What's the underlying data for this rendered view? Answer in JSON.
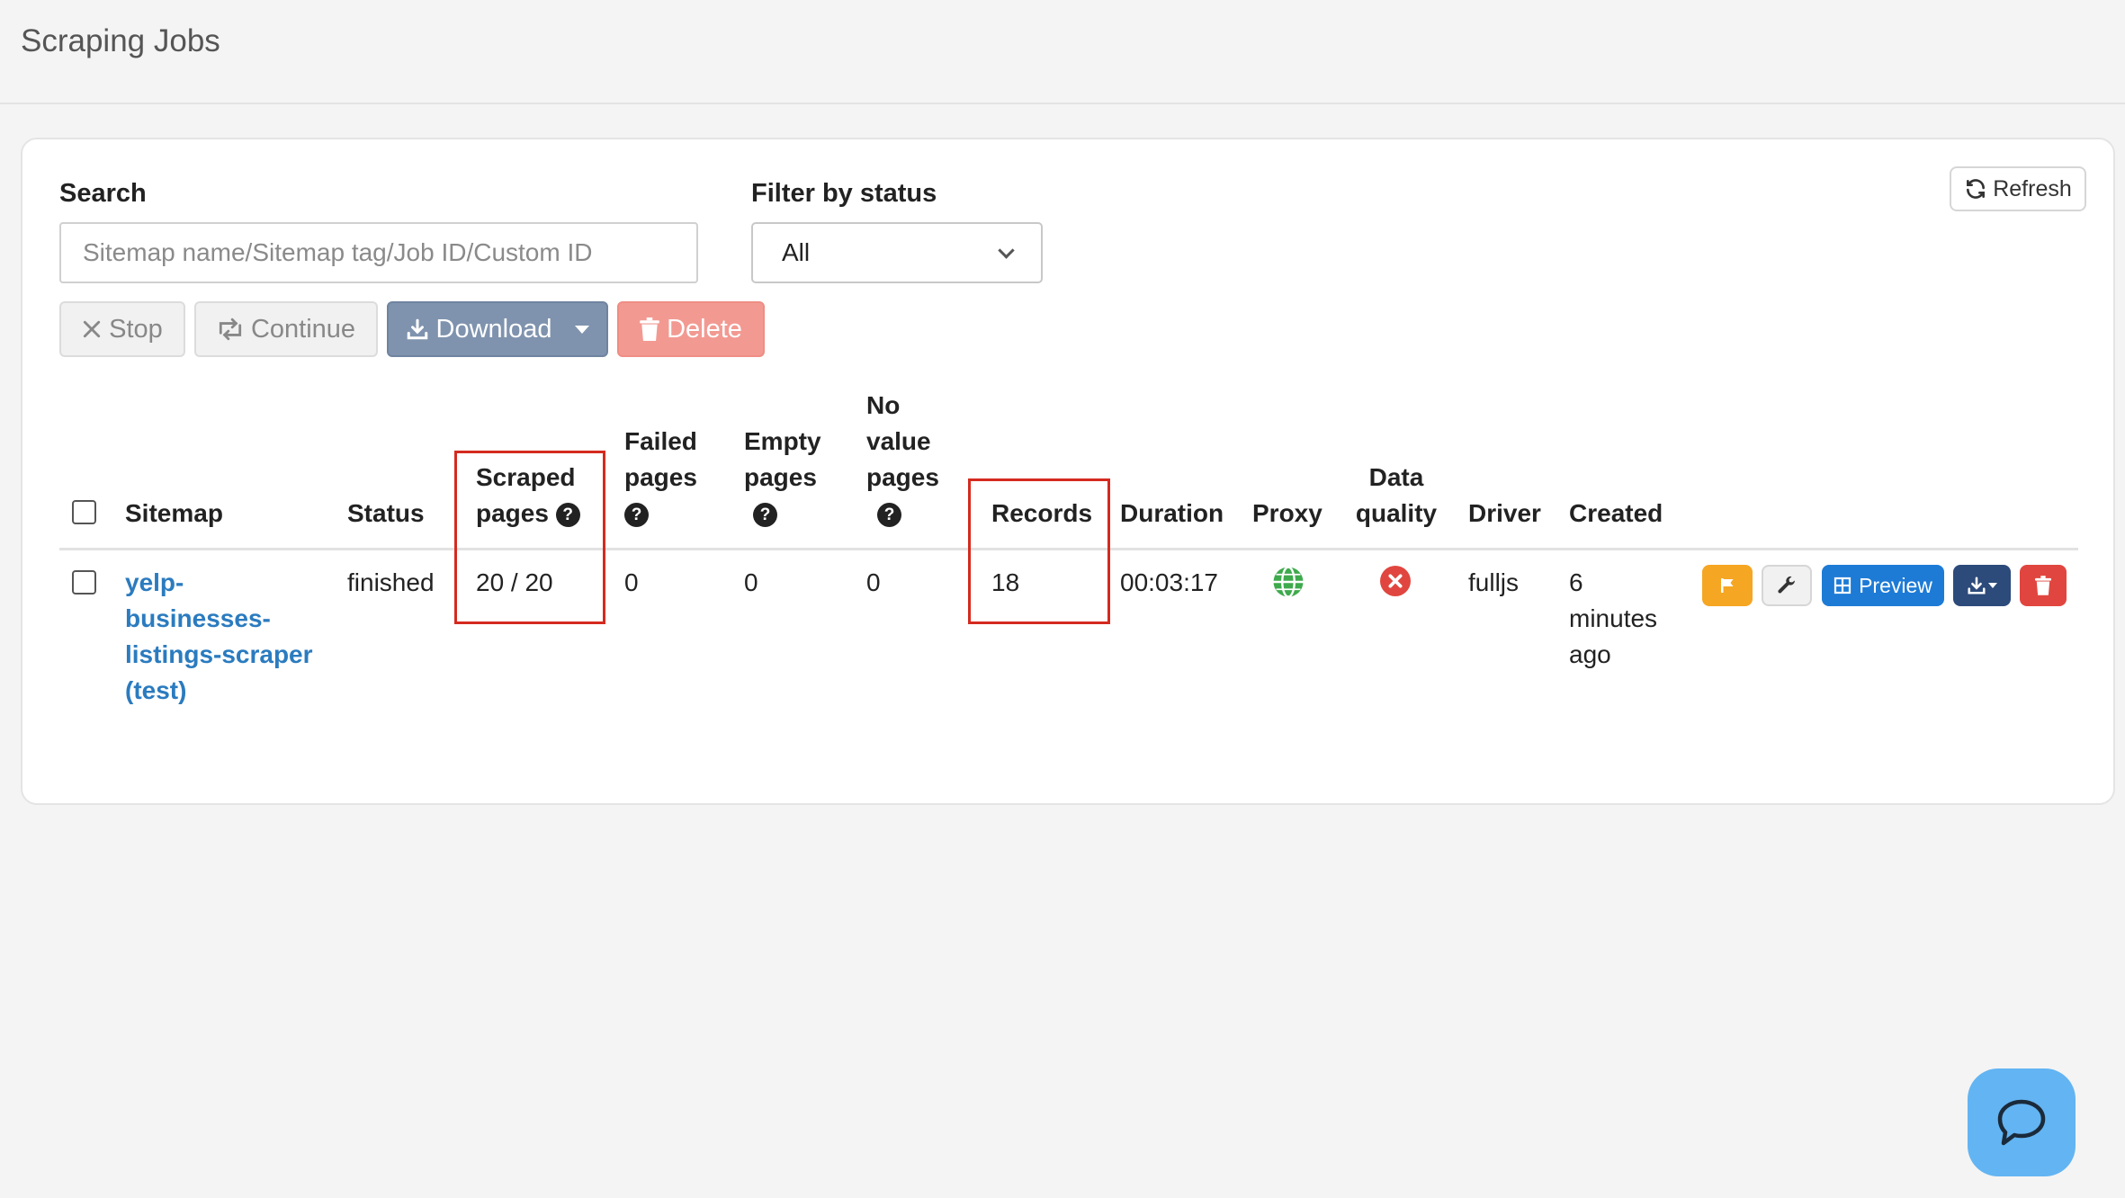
{
  "header": {
    "title": "Scraping Jobs"
  },
  "controls": {
    "search_label": "Search",
    "search_placeholder": "Sitemap name/Sitemap tag/Job ID/Custom ID",
    "filter_label": "Filter by status",
    "filter_value": "All",
    "refresh_label": "Refresh",
    "stop_label": "Stop",
    "continue_label": "Continue",
    "download_label": "Download",
    "delete_label": "Delete"
  },
  "table": {
    "headers": {
      "sitemap": "Sitemap",
      "status": "Status",
      "scraped_1": "Scraped",
      "scraped_2": "pages",
      "failed_1": "Failed",
      "failed_2": "pages",
      "empty_1": "Empty",
      "empty_2": "pages",
      "novalue_1": "No",
      "novalue_2": "value",
      "novalue_3": "pages",
      "records": "Records",
      "duration": "Duration",
      "proxy": "Proxy",
      "quality_1": "Data",
      "quality_2": "quality",
      "driver": "Driver",
      "created": "Created"
    },
    "help_glyph": "?",
    "rows": [
      {
        "sitemap_lines": [
          "yelp-",
          "businesses-",
          "listings-scraper",
          "(test)"
        ],
        "status": "finished",
        "scraped_pages": "20 / 20",
        "failed_pages": "0",
        "empty_pages": "0",
        "no_value_pages": "0",
        "records": "18",
        "duration": "00:03:17",
        "driver": "fulljs",
        "created_lines": [
          "6",
          "minutes",
          "ago"
        ],
        "preview_label": "Preview"
      }
    ]
  },
  "colors": {
    "link": "#2b7bbf",
    "highlight": "#d52a1f",
    "flag_button": "#f5a623",
    "preview_button": "#1d7bd6",
    "download_action": "#2c4a7a",
    "delete_action": "#e0463f",
    "proxy_globe": "#3eaa4d",
    "quality_error": "#e0463f"
  },
  "icons": [
    "x-icon",
    "continue-icon",
    "download-icon",
    "trash-icon",
    "refresh-icon",
    "help-icon",
    "globe-icon",
    "error-circle-icon",
    "flag-icon",
    "wrench-icon",
    "table-icon",
    "chat-icon"
  ]
}
